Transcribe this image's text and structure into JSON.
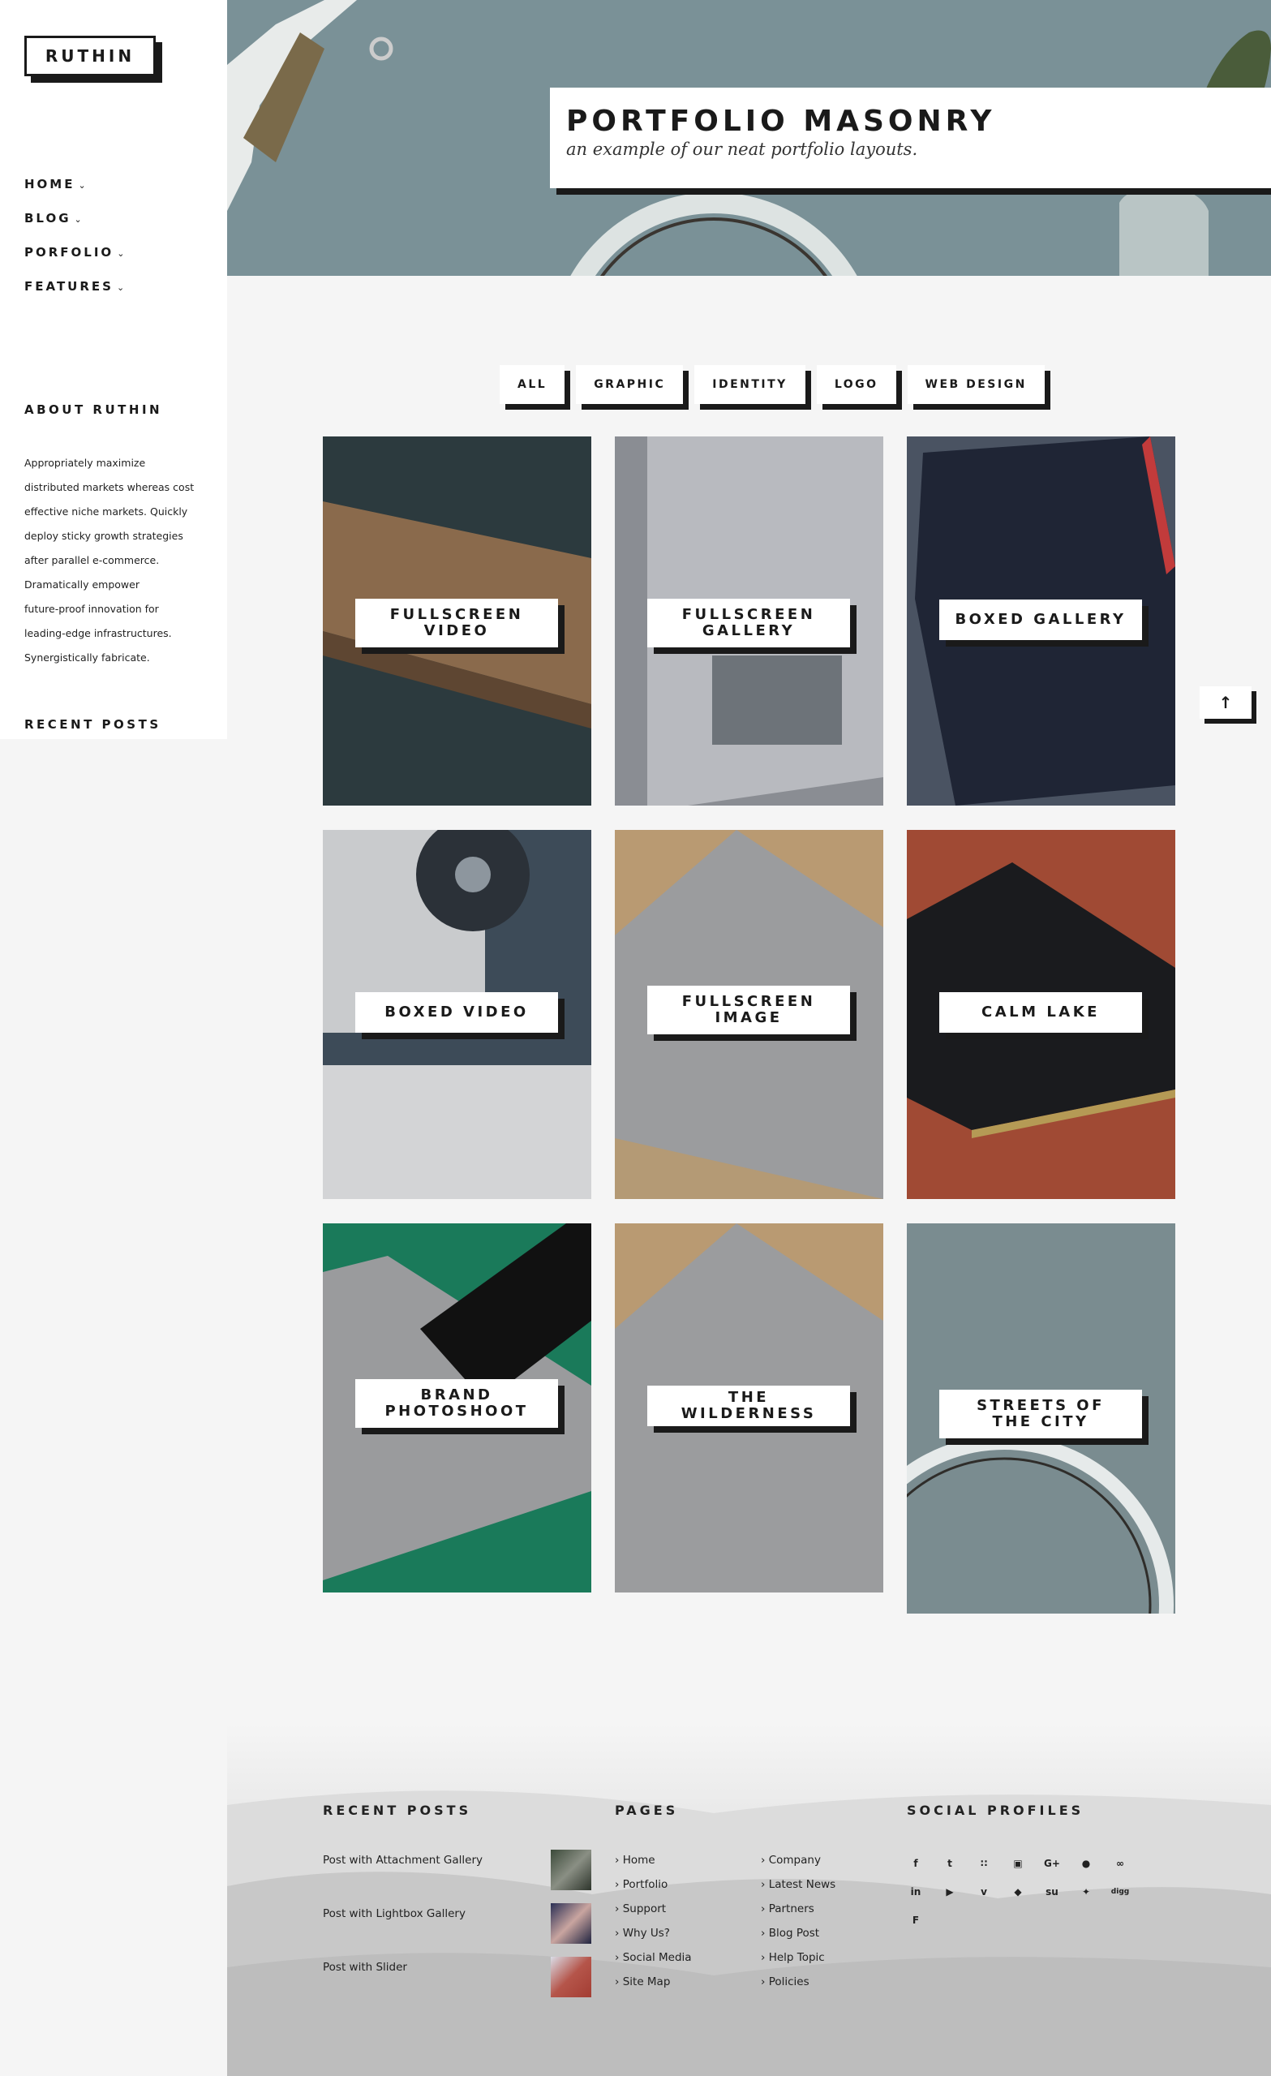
{
  "brand": {
    "logo": "RUTHIN"
  },
  "nav": [
    {
      "label": "HOME"
    },
    {
      "label": "BLOG"
    },
    {
      "label": "PORFOLIO"
    },
    {
      "label": "FEATURES"
    }
  ],
  "sidebar": {
    "about_heading": "ABOUT RUTHIN",
    "about_lines": [
      "Appropriately maximize",
      "distributed markets whereas cost",
      "effective niche markets. Quickly",
      "deploy sticky growth strategies",
      "after parallel e-commerce.",
      "Dramatically empower",
      "future-proof innovation for",
      "leading-edge infrastructures.",
      "Synergistically fabricate."
    ],
    "recent_heading": "RECENT POSTS"
  },
  "hero": {
    "title": "PORTFOLIO MASONRY",
    "subtitle": "an example of our neat portfolio layouts."
  },
  "filters": [
    "ALL",
    "GRAPHIC",
    "IDENTITY",
    "LOGO",
    "WEB DESIGN"
  ],
  "tiles": [
    {
      "label": "FULLSCREEN VIDEO"
    },
    {
      "label": "FULLSCREEN GALLERY"
    },
    {
      "label": "BOXED GALLERY"
    },
    {
      "label": "BOXED VIDEO"
    },
    {
      "label": "FULLSCREEN IMAGE"
    },
    {
      "label": "CALM LAKE"
    },
    {
      "label": "BRAND PHOTOSHOOT"
    },
    {
      "label": "THE WILDERNESS"
    },
    {
      "label": "STREETS OF THE CITY"
    }
  ],
  "back_to_top": "↑",
  "footer": {
    "recent_heading": "RECENT POSTS",
    "posts": [
      "Post with Attachment Gallery",
      "Post with Lightbox Gallery",
      "Post with Slider"
    ],
    "pages_heading": "PAGES",
    "pages_col1": [
      "Home",
      "Portfolio",
      "Support",
      "Why Us?",
      "Social Media",
      "Site Map"
    ],
    "pages_col2": [
      "Company",
      "Latest News",
      "Partners",
      "Blog Post",
      "Help Topic",
      "Policies"
    ],
    "social_heading": "SOCIAL PROFILES",
    "social_icons": [
      {
        "name": "facebook-icon",
        "glyph": "f"
      },
      {
        "name": "twitter-icon",
        "glyph": "t"
      },
      {
        "name": "rss-icon",
        "glyph": "∷"
      },
      {
        "name": "instagram-icon",
        "glyph": "▣"
      },
      {
        "name": "google-plus-icon",
        "glyph": "G+"
      },
      {
        "name": "flickr-icon",
        "glyph": "●"
      },
      {
        "name": "lastfm-icon",
        "glyph": "∞"
      },
      {
        "name": "linkedin-icon",
        "glyph": "in"
      },
      {
        "name": "youtube-icon",
        "glyph": "▶"
      },
      {
        "name": "vimeo-icon",
        "glyph": "v"
      },
      {
        "name": "dropbox-icon",
        "glyph": "◆"
      },
      {
        "name": "stumbleupon-icon",
        "glyph": "su"
      },
      {
        "name": "delicious-icon",
        "glyph": "✦"
      },
      {
        "name": "digg-icon",
        "glyph": "digg"
      },
      {
        "name": "foursquare-icon",
        "glyph": "F"
      }
    ]
  },
  "colors": {
    "accent": "#1a1a1a",
    "background": "#f5f5f5"
  }
}
